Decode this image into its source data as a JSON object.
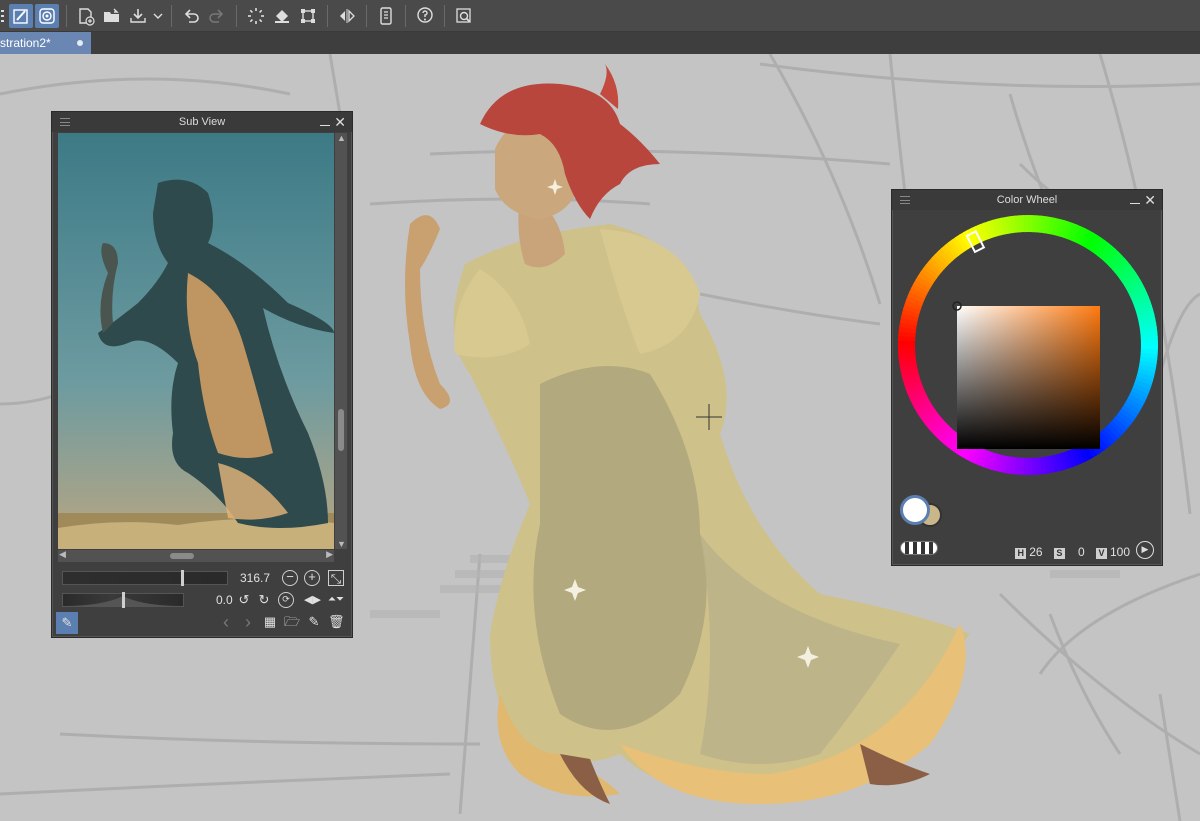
{
  "toolbar": {
    "icons": [
      "menu-icon",
      "pen-icon",
      "spiral-icon",
      "new-canvas-icon",
      "open-folder-icon",
      "export-icon",
      "chevron-down-icon",
      "undo-icon",
      "redo-icon",
      "loading-icon",
      "fill-icon",
      "transform-icon",
      "flip-icon",
      "phone-icon",
      "help-icon",
      "search-icon"
    ]
  },
  "tab": {
    "title": "stration2*"
  },
  "subview": {
    "title": "Sub View",
    "zoom_value": "316.7",
    "rotate_value": "0.0"
  },
  "colorwheel": {
    "title": "Color Wheel",
    "h_label": "H",
    "h_value": "26",
    "s_label": "S",
    "s_value": "0",
    "v_label": "V",
    "v_value": "100",
    "colors": {
      "main": "#ffffff",
      "sub": "#c9b68a"
    }
  }
}
